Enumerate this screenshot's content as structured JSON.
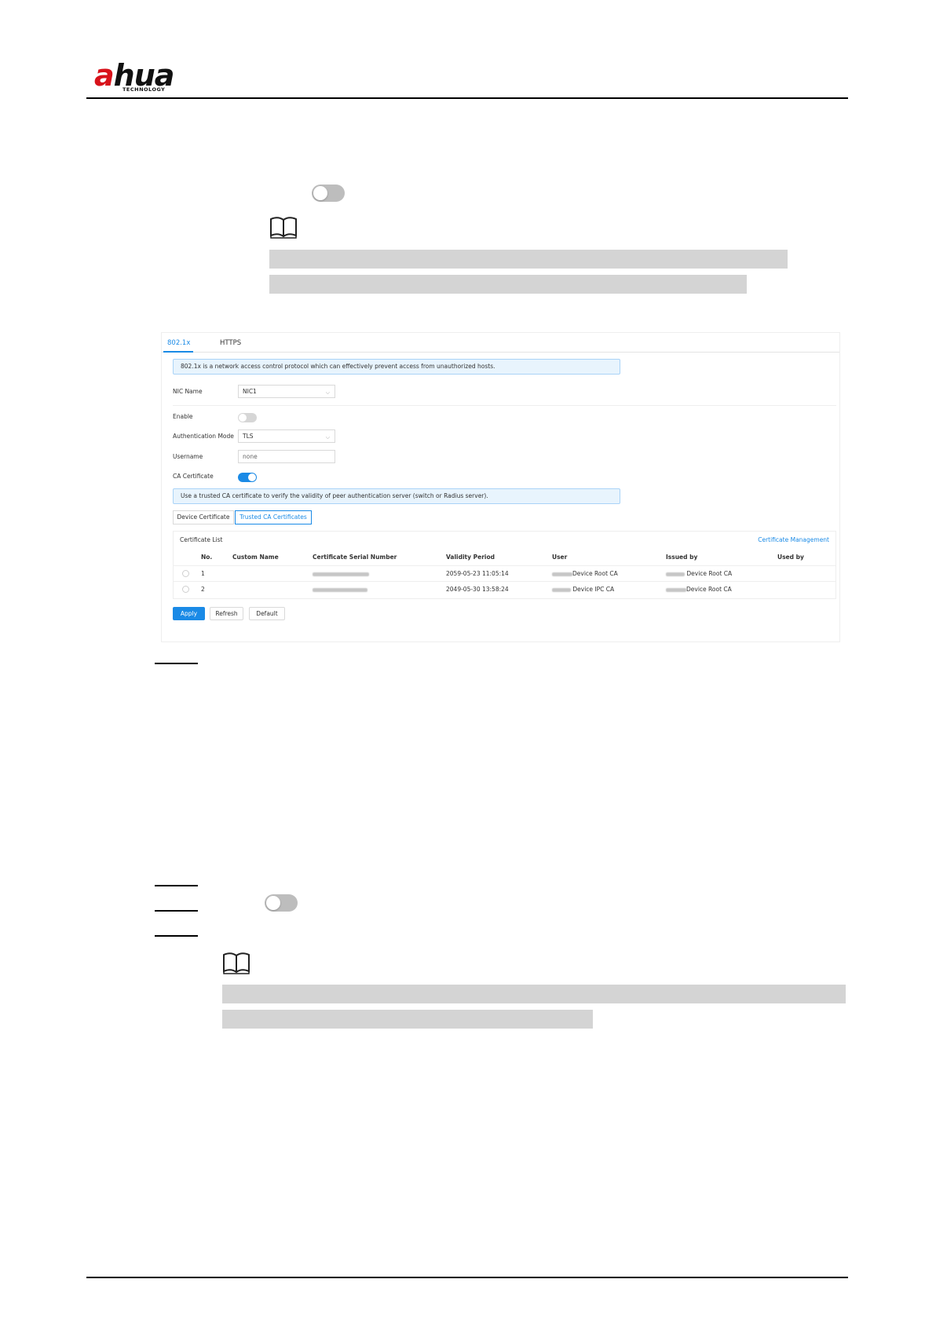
{
  "header": {
    "logo_main": "hua",
    "logo_accent": "a",
    "logo_sub": "TECHNOLOGY"
  },
  "panel": {
    "tabs": [
      {
        "label": "802.1x",
        "active": true
      },
      {
        "label": "HTTPS",
        "active": false
      }
    ],
    "info_top": "802.1x is a network access control protocol which can effectively prevent access from unauthorized hosts.",
    "nic_name": {
      "label": "NIC Name",
      "value": "NIC1"
    },
    "enable": {
      "label": "Enable",
      "on": false
    },
    "auth_mode": {
      "label": "Authentication Mode",
      "value": "TLS"
    },
    "username": {
      "label": "Username",
      "value": "none"
    },
    "ca_certificate": {
      "label": "CA Certificate",
      "on": true
    },
    "info_ca": "Use a trusted CA certificate to verify the validity of peer authentication server (switch or Radius server).",
    "subtabs": [
      {
        "label": "Device Certificate",
        "active": false
      },
      {
        "label": "Trusted CA Certificates",
        "active": true
      }
    ],
    "certificate_list": {
      "title": "Certificate List",
      "management_link": "Certificate Management",
      "columns": [
        "No.",
        "Custom Name",
        "Certificate Serial Number",
        "Validity Period",
        "User",
        "Issued by",
        "Used by"
      ],
      "rows": [
        {
          "no": "1",
          "custom_name": "",
          "validity": "2059-05-23 11:05:14",
          "user": "Device Root CA",
          "issued_by": "Device Root CA",
          "used_by": ""
        },
        {
          "no": "2",
          "custom_name": "",
          "validity": "2049-05-30 13:58:24",
          "user": "Device IPC CA",
          "issued_by": "Device Root CA",
          "used_by": ""
        }
      ]
    },
    "buttons": {
      "apply": "Apply",
      "refresh": "Refresh",
      "default": "Default"
    }
  },
  "colors": {
    "accent": "#1a8ae6",
    "logo_red": "#d8121b",
    "redaction_grey": "#d4d4d4"
  },
  "icons": [
    "book-note-icon",
    "toggle-switch-icon",
    "chevron-down-icon",
    "radio-icon"
  ]
}
